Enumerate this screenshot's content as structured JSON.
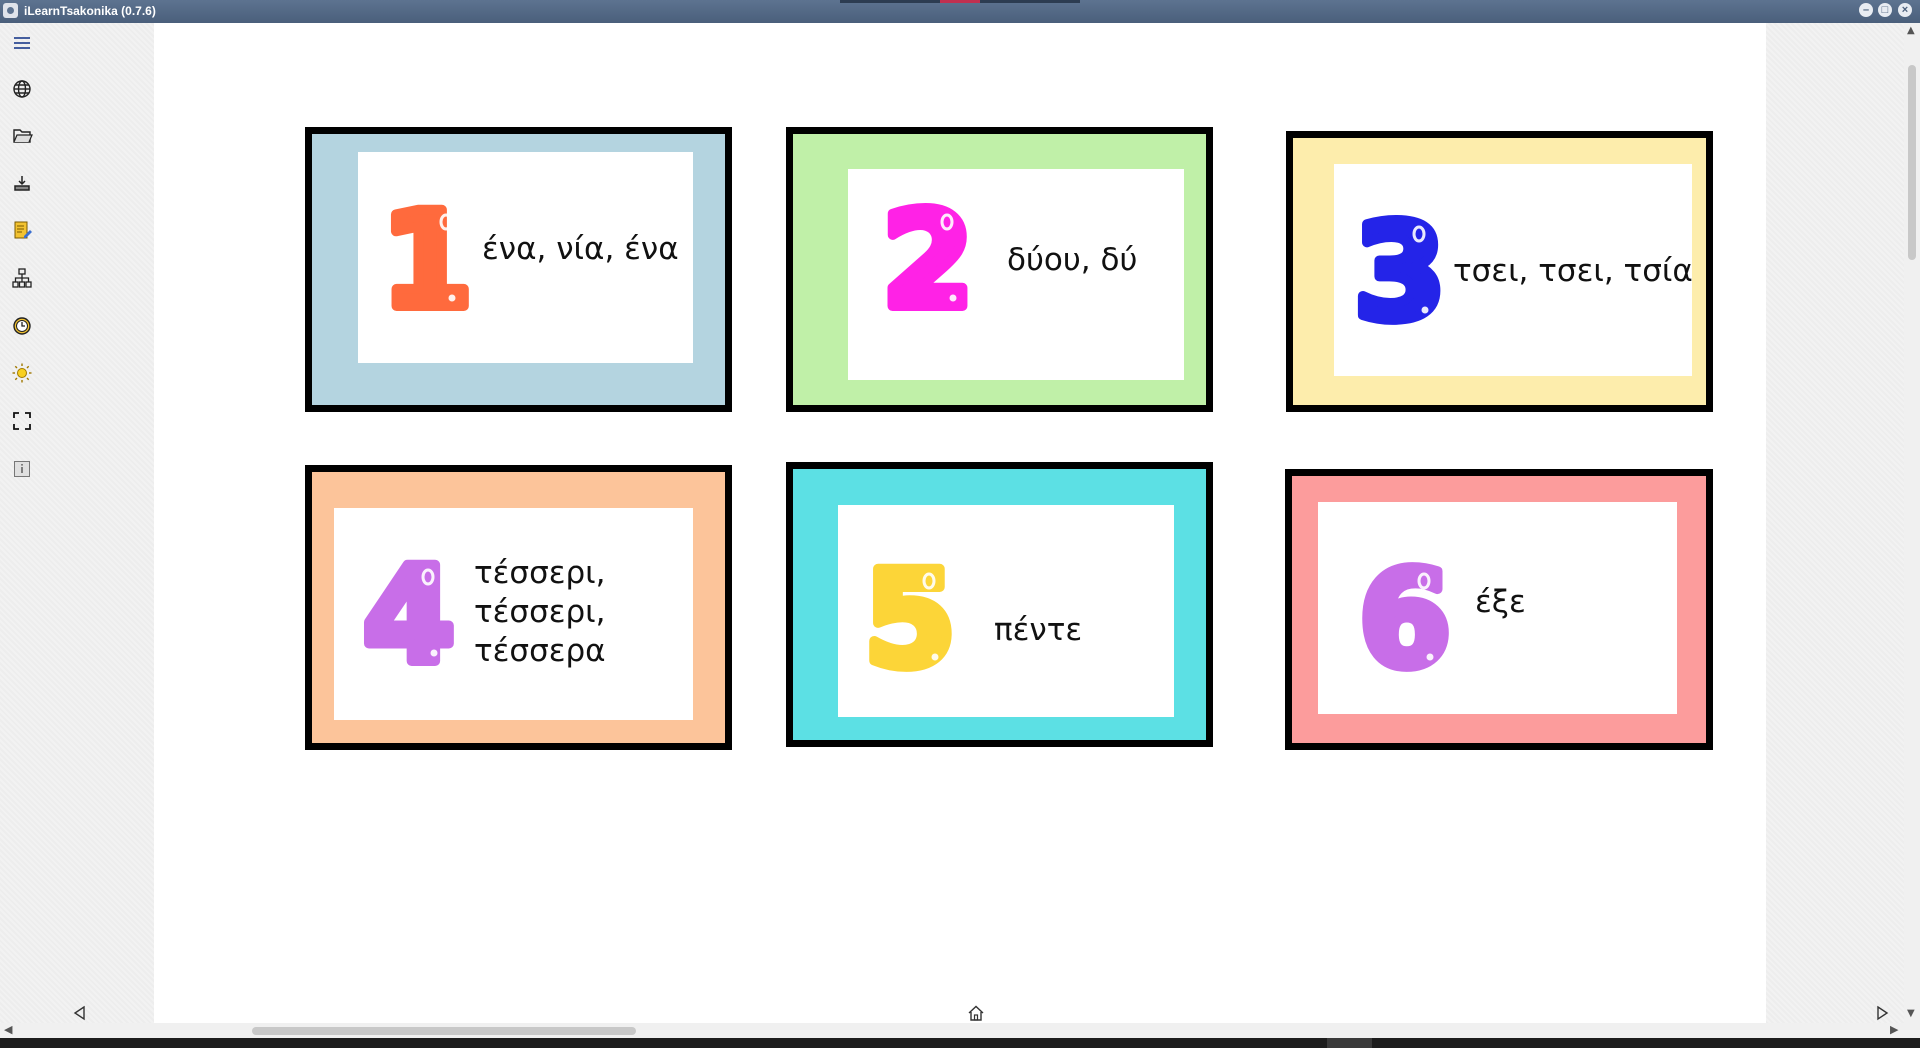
{
  "window": {
    "title": "iLearnTsakonika (0.7.6)",
    "controls": [
      "minimize",
      "maximize",
      "close"
    ]
  },
  "sidebar": {
    "items": [
      {
        "name": "menu-icon"
      },
      {
        "name": "globe-icon"
      },
      {
        "name": "folder-open-icon"
      },
      {
        "name": "download-icon"
      },
      {
        "name": "edit-document-icon"
      },
      {
        "name": "sitemap-icon"
      },
      {
        "name": "clock-icon"
      },
      {
        "name": "brightness-icon"
      },
      {
        "name": "fullscreen-icon"
      },
      {
        "name": "info-icon"
      }
    ]
  },
  "cards": [
    {
      "numeral": "1",
      "numeral_color": "#ff6a3d",
      "frame_color": "#b4d4e0",
      "lines": [
        "ένα, νία, ένα"
      ]
    },
    {
      "numeral": "2",
      "numeral_color": "#ff22e6",
      "frame_color": "#c0f0a8",
      "lines": [
        "δύου, δύ"
      ]
    },
    {
      "numeral": "3",
      "numeral_color": "#2424e8",
      "frame_color": "#fdedac",
      "lines": [
        "τσει, τσει, τσία"
      ]
    },
    {
      "numeral": "4",
      "numeral_color": "#c86ee8",
      "frame_color": "#fcc49a",
      "lines": [
        "τέσσερι,",
        "τέσσερι,",
        "τέσσερα"
      ]
    },
    {
      "numeral": "5",
      "numeral_color": "#fcd538",
      "frame_color": "#5ce0e4",
      "lines": [
        "πέντε"
      ]
    },
    {
      "numeral": "6",
      "numeral_color": "#c86ee8",
      "frame_color": "#fc9c9c",
      "lines": [
        "έξε"
      ]
    }
  ],
  "navigation": {
    "previous": "previous-page",
    "home": "home",
    "next": "next-page"
  }
}
